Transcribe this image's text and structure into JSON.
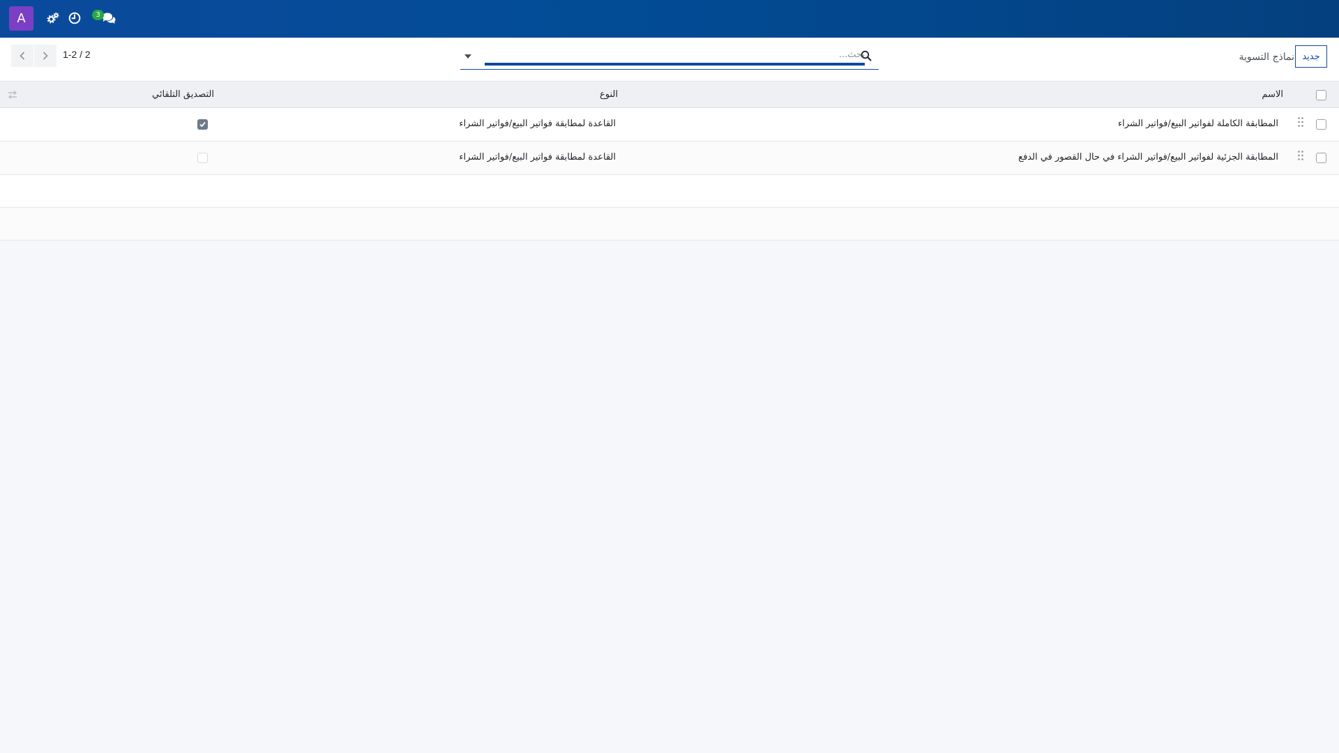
{
  "navbar": {
    "avatar_letter": "A",
    "icons": [
      "settings-icon",
      "clock-icon",
      "chat-icon"
    ],
    "chat_badge": "3",
    "colors": {
      "bar": "#0b4a9c",
      "avatar": "#7a3fc4",
      "badge": "#28a745"
    }
  },
  "control_panel": {
    "new_button_label": "جديد",
    "title": "نماذج التسوية",
    "search_placeholder": "بحث...",
    "pager": "1-2 / 2"
  },
  "table": {
    "columns": {
      "name": "الاسم",
      "type": "النوع",
      "auto_validate": "التصديق التلقائي"
    },
    "rows": [
      {
        "name": "المطابقة الكاملة لفواتير البيع/فواتير الشراء",
        "type": "القاعدة لمطابقة فواتير البيع/فواتير الشراء",
        "auto_validate": true
      },
      {
        "name": "المطابقة الجزئية لفواتير البيع/فواتير الشراء في حال القصور في الدفع",
        "type": "القاعدة لمطابقة فواتير البيع/فواتير الشراء",
        "auto_validate": false
      }
    ]
  }
}
